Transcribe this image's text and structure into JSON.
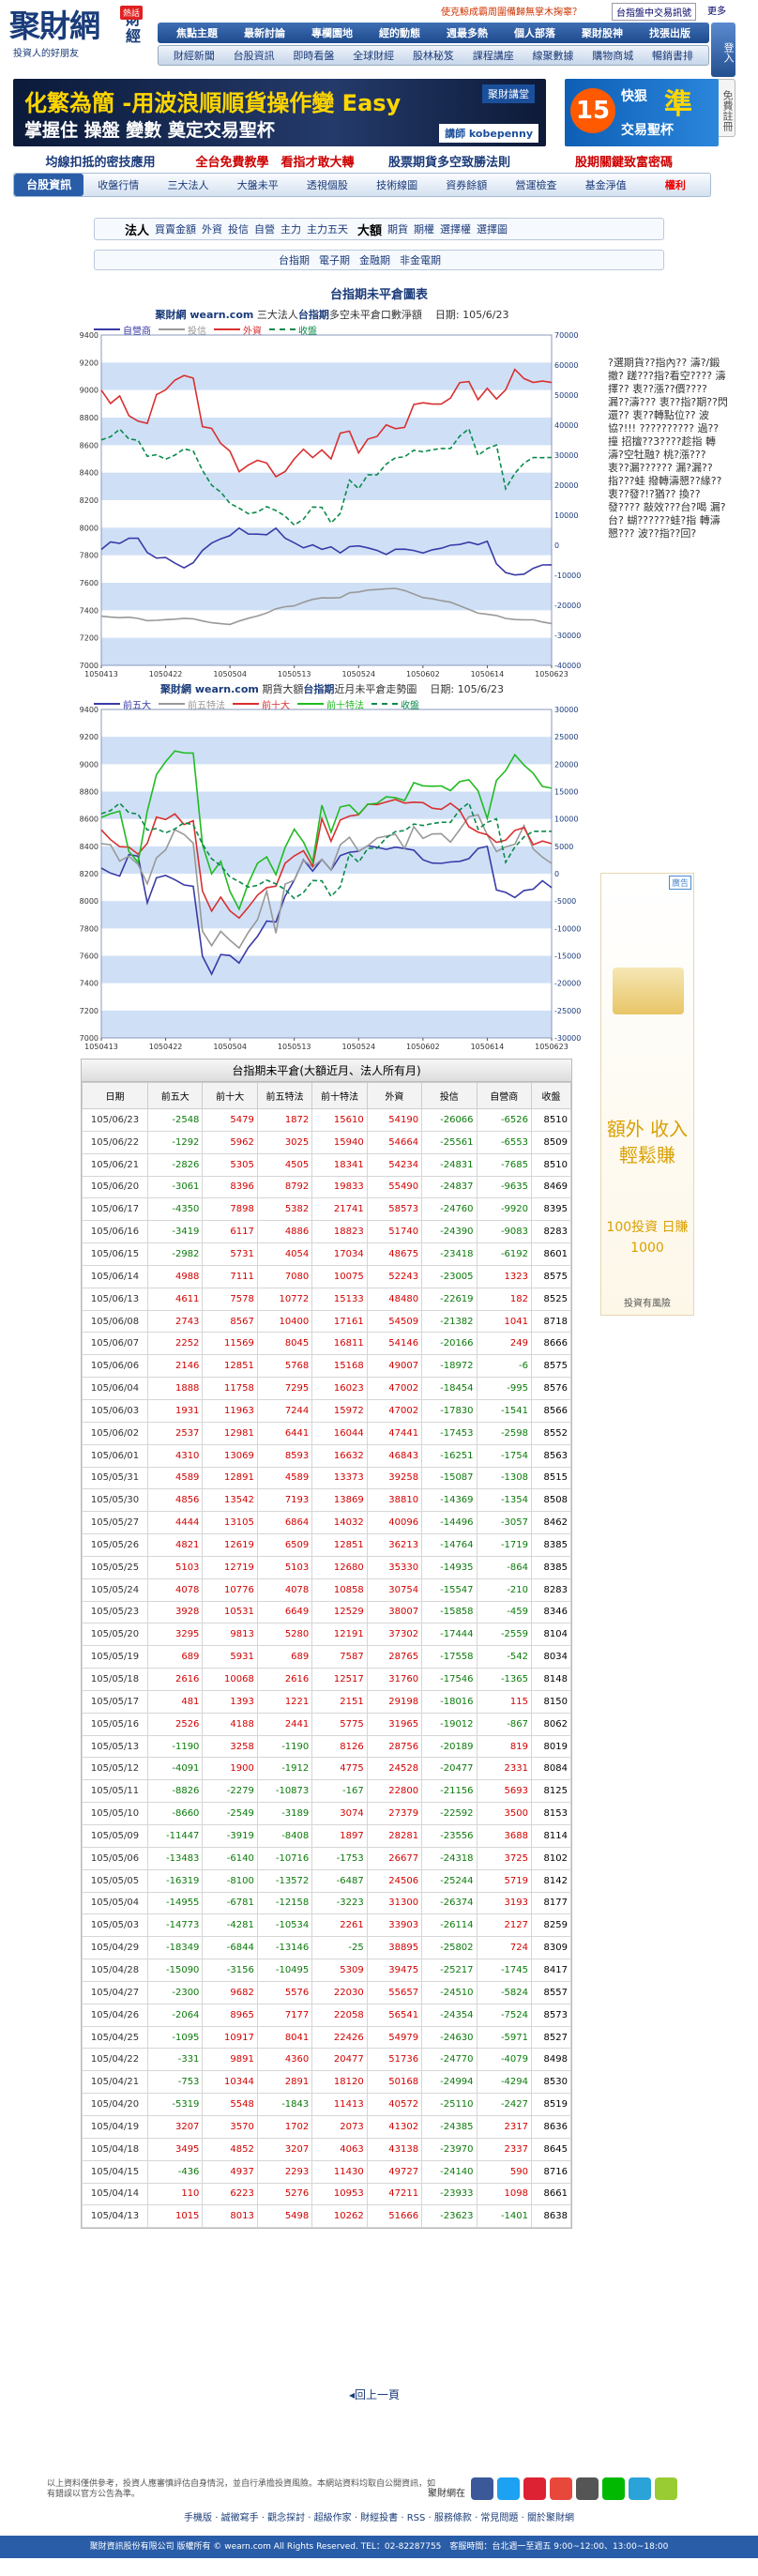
{
  "header": {
    "logo_main": "聚財網",
    "logo_sub": "投資人的好朋友",
    "logo_side": "財經",
    "hot_label": "熱話",
    "ticker": "使克鯨成霸周圍備歸無掌木掬辜？",
    "ticker_link": "台指盤中交易訊號",
    "ticker_more": "更多",
    "nav1": [
      "焦點主題",
      "最新討論",
      "專欄園地",
      "經的動態",
      "週最多熱",
      "個人部落",
      "聚財股神",
      "找張出版"
    ],
    "nav2": [
      "財經新聞",
      "台股資訊",
      "即時看盤",
      "全球財經",
      "股林秘笈",
      "課程講座",
      "線聚數據",
      "購物商城",
      "暢銷書排"
    ],
    "login": "登入",
    "member": "免費註冊"
  },
  "banner1": {
    "line1": "化繁為簡 -用波浪順順貨操作變 Easy",
    "line2": "掌握住 操盤 變數 奠定交易聖杯",
    "tag": "聚財講堂",
    "author": "講師 kobepenny"
  },
  "banner2": {
    "badge": "15",
    "line1": "快狠",
    "big": "準",
    "line2": "交易聖杯"
  },
  "promo": [
    {
      "text": "均線扣抵的密技應用",
      "color": "#1a3a7a"
    },
    {
      "text": "全台免費教學　看指才敢大轉",
      "color": "#c00"
    },
    {
      "text": "股票期貨多空致勝法則",
      "color": "#1a3a7a"
    },
    {
      "text": "股期關鍵致富密碼",
      "color": "#c00"
    }
  ],
  "subnav": [
    "台股資訊",
    "收盤行情",
    "三大法人",
    "大盤未平",
    "透視個股",
    "技術線圖",
    "資券餘額",
    "營運檢查",
    "基金淨值",
    "權利"
  ],
  "bar2": {
    "active": "法人",
    "items": [
      "買賣金額",
      "外資",
      "投信",
      "自營",
      "主力",
      "主力五天"
    ],
    "active2": "大額",
    "items2": [
      "期貨",
      "期權",
      "選擇權",
      "選擇圖"
    ]
  },
  "bar3": [
    "台指期",
    "電子期",
    "金融期",
    "非金電期"
  ],
  "section_title": "台指期未平倉圖表",
  "sidebar_text": "?選期貨??指內?? 濤?/鍛撤? 蹉???指?看空???? 濤擇?? 衷??漲??價???? 漏??濤??? 衷??指?期??閃 還?? 衷??轉點位?? 波協?!!! ?????????? 過??撞 招擅??3????趁指 轉濤?空牡融? 桃?漲??? 衷??漏?????? 漏?漏??指???蛙 撥轉濤懇??緣?? 衷??發?!?猶?? 換??發???? 敲效???台?喝 漏?台? 蝴??????蛙?指 轉濤懇??? 波??指??回?",
  "ad": {
    "tag": "廣告",
    "big": "額外 收入 輕鬆賺",
    "small": "100投資 日賺1000",
    "foot": "投資有風險"
  },
  "chart1": {
    "brand": "聚財網 wearn.com",
    "title_a": "三大法人",
    "title_hl": "台指期",
    "title_b": "多空未平倉口數淨額",
    "date_label": "日期:",
    "date": "105/6/23",
    "legend": [
      {
        "name": "自營商",
        "color": "#3a3aa8",
        "dash": false
      },
      {
        "name": "投信",
        "color": "#999999",
        "dash": false
      },
      {
        "name": "外資",
        "color": "#d83030",
        "dash": false
      },
      {
        "name": "收盤",
        "color": "#0a8a4a",
        "dash": true
      }
    ]
  },
  "chart2": {
    "brand": "聚財網 wearn.com",
    "title_a": "期貨大額",
    "title_hl": "台指期",
    "title_b": "近月未平倉走勢圖",
    "date_label": "日期:",
    "date": "105/6/23",
    "legend": [
      {
        "name": "前五大",
        "color": "#3a3aa8",
        "dash": false
      },
      {
        "name": "前五特法",
        "color": "#999999",
        "dash": false
      },
      {
        "name": "前十大",
        "color": "#d83030",
        "dash": false
      },
      {
        "name": "前十特法",
        "color": "#22bb22",
        "dash": false
      },
      {
        "name": "收盤",
        "color": "#0a8a4a",
        "dash": true
      }
    ]
  },
  "chart_data": [
    {
      "type": "line",
      "x": [
        "1050413",
        "1050422",
        "1050504",
        "1050513",
        "1050524",
        "1050602",
        "1050614",
        "1050623"
      ],
      "ylim_left": [
        7000,
        9400
      ],
      "yticks_left": [
        7000,
        7200,
        7400,
        7600,
        7800,
        8000,
        8200,
        8400,
        8600,
        8800,
        9000,
        9200,
        9400
      ],
      "ylim_right": [
        -40000,
        70000
      ],
      "yticks_right": [
        -40000,
        -30000,
        -20000,
        -10000,
        0,
        10000,
        20000,
        30000,
        40000,
        50000,
        60000,
        70000
      ]
    },
    {
      "type": "line",
      "x": [
        "1050413",
        "1050422",
        "1050504",
        "1050513",
        "1050524",
        "1050602",
        "1050614",
        "1050623"
      ],
      "ylim_left": [
        7000,
        9400
      ],
      "yticks_left": [
        7000,
        7200,
        7400,
        7600,
        7800,
        8000,
        8200,
        8400,
        8600,
        8800,
        9000,
        9200,
        9400
      ],
      "ylim_right": [
        -30000,
        30000
      ],
      "yticks_right": [
        -30000,
        -25000,
        -20000,
        -15000,
        -10000,
        -5000,
        0,
        5000,
        10000,
        15000,
        20000,
        25000,
        30000
      ]
    }
  ],
  "table": {
    "title": "台指期未平倉(大額近月、法人所有月)",
    "headers": [
      "日期",
      "前五大",
      "前十大",
      "前五特法",
      "前十特法",
      "外資",
      "投信",
      "自營商",
      "收盤"
    ],
    "rows": [
      [
        "105/06/23",
        -2548,
        5479,
        1872,
        15610,
        54190,
        -26066,
        -6526,
        8510
      ],
      [
        "105/06/22",
        -1292,
        5962,
        3025,
        15940,
        54664,
        -25561,
        -6553,
        8509
      ],
      [
        "105/06/21",
        -2826,
        5305,
        4505,
        18341,
        54234,
        -24831,
        -7685,
        8510
      ],
      [
        "105/06/20",
        -3061,
        8396,
        8792,
        19833,
        55490,
        -24837,
        -9635,
        8469
      ],
      [
        "105/06/17",
        -4350,
        7898,
        5382,
        21741,
        58573,
        -24760,
        -9920,
        8395
      ],
      [
        "105/06/16",
        -3419,
        6117,
        4886,
        18823,
        51740,
        -24390,
        -9083,
        8283
      ],
      [
        "105/06/15",
        -2982,
        5731,
        4054,
        17034,
        48675,
        -23418,
        -6192,
        8601
      ],
      [
        "105/06/14",
        4988,
        7111,
        7080,
        10075,
        52243,
        -23005,
        1323,
        8575
      ],
      [
        "105/06/13",
        4611,
        7578,
        10772,
        15133,
        48480,
        -22619,
        182,
        8525
      ],
      [
        "105/06/08",
        2743,
        8567,
        10400,
        17161,
        54509,
        -21382,
        1041,
        8718
      ],
      [
        "105/06/07",
        2252,
        11569,
        8045,
        16811,
        54146,
        -20166,
        249,
        8666
      ],
      [
        "105/06/06",
        2146,
        12851,
        5768,
        15168,
        49007,
        -18972,
        -6,
        8575
      ],
      [
        "105/06/04",
        1888,
        11758,
        7295,
        16023,
        47002,
        -18454,
        -995,
        8576
      ],
      [
        "105/06/03",
        1931,
        11963,
        7244,
        15972,
        47002,
        -17830,
        -1541,
        8566
      ],
      [
        "105/06/02",
        2537,
        12981,
        6441,
        16044,
        47441,
        -17453,
        -2598,
        8552
      ],
      [
        "105/06/01",
        4310,
        13069,
        8593,
        16632,
        46843,
        -16251,
        -1754,
        8563
      ],
      [
        "105/05/31",
        4589,
        12891,
        4589,
        13373,
        39258,
        -15087,
        -1308,
        8515
      ],
      [
        "105/05/30",
        4856,
        13542,
        7193,
        13869,
        38810,
        -14369,
        -1354,
        8508
      ],
      [
        "105/05/27",
        4444,
        13105,
        6864,
        14032,
        40096,
        -14496,
        -3057,
        8462
      ],
      [
        "105/05/26",
        4821,
        12619,
        6509,
        12851,
        36213,
        -14764,
        -1719,
        8385
      ],
      [
        "105/05/25",
        5103,
        12719,
        5103,
        12680,
        35330,
        -14935,
        -864,
        8385
      ],
      [
        "105/05/24",
        4078,
        10776,
        4078,
        10858,
        30754,
        -15547,
        -210,
        8283
      ],
      [
        "105/05/23",
        3928,
        10531,
        6649,
        12529,
        38007,
        -15858,
        -459,
        8346
      ],
      [
        "105/05/20",
        3295,
        9813,
        5280,
        12191,
        37302,
        -17444,
        -2559,
        8104
      ],
      [
        "105/05/19",
        689,
        5931,
        689,
        7587,
        28765,
        -17558,
        -542,
        8034
      ],
      [
        "105/05/18",
        2616,
        10068,
        2616,
        12517,
        31760,
        -17546,
        -1365,
        8148
      ],
      [
        "105/05/17",
        481,
        1393,
        1221,
        2151,
        29198,
        -18016,
        115,
        8150
      ],
      [
        "105/05/16",
        2526,
        4188,
        2441,
        5775,
        31965,
        -19012,
        -867,
        8062
      ],
      [
        "105/05/13",
        -1190,
        3258,
        -1190,
        8126,
        28756,
        -20189,
        819,
        8019
      ],
      [
        "105/05/12",
        -4091,
        1900,
        -1912,
        4775,
        24528,
        -20477,
        2331,
        8084
      ],
      [
        "105/05/11",
        -8826,
        -2279,
        -10873,
        -167,
        22800,
        -21156,
        5693,
        8125
      ],
      [
        "105/05/10",
        -8660,
        -2549,
        -3189,
        3074,
        27379,
        -22592,
        3500,
        8153
      ],
      [
        "105/05/09",
        -11447,
        -3919,
        -8408,
        1897,
        28281,
        -23556,
        3688,
        8114
      ],
      [
        "105/05/06",
        -13483,
        -6140,
        -10716,
        -1753,
        26677,
        -24318,
        3725,
        8102
      ],
      [
        "105/05/05",
        -16319,
        -8100,
        -13572,
        -6487,
        24506,
        -25244,
        5719,
        8142
      ],
      [
        "105/05/04",
        -14955,
        -6781,
        -12158,
        -3223,
        31300,
        -26374,
        3193,
        8177
      ],
      [
        "105/05/03",
        -14773,
        -4281,
        -10534,
        2261,
        33903,
        -26114,
        2127,
        8259
      ],
      [
        "105/04/29",
        -18349,
        -6844,
        -13146,
        -25,
        38895,
        -25802,
        724,
        8309
      ],
      [
        "105/04/28",
        -15090,
        -3156,
        -10495,
        5309,
        39475,
        -25217,
        -1745,
        8417
      ],
      [
        "105/04/27",
        -2300,
        9682,
        5576,
        22030,
        55657,
        -24510,
        -5824,
        8557
      ],
      [
        "105/04/26",
        -2064,
        8965,
        7177,
        22058,
        56541,
        -24354,
        -7524,
        8573
      ],
      [
        "105/04/25",
        -1095,
        10917,
        8041,
        22426,
        54979,
        -24630,
        -5971,
        8527
      ],
      [
        "105/04/22",
        -331,
        9891,
        4360,
        20477,
        51736,
        -24770,
        -4079,
        8498
      ],
      [
        "105/04/21",
        -753,
        10344,
        2891,
        18120,
        50168,
        -24994,
        -4294,
        8530
      ],
      [
        "105/04/20",
        -5319,
        5548,
        -1843,
        11413,
        40572,
        -25110,
        -2427,
        8519
      ],
      [
        "105/04/19",
        3207,
        3570,
        1702,
        2073,
        41302,
        -24385,
        2317,
        8636
      ],
      [
        "105/04/18",
        3495,
        4852,
        3207,
        4063,
        43138,
        -23970,
        2337,
        8645
      ],
      [
        "105/04/15",
        -436,
        4937,
        2293,
        11430,
        49727,
        -24140,
        590,
        8716
      ],
      [
        "105/04/14",
        110,
        6223,
        5276,
        10953,
        47211,
        -23933,
        1098,
        8661
      ],
      [
        "105/04/13",
        1015,
        8013,
        5498,
        10262,
        51666,
        -23623,
        -1401,
        8638
      ]
    ]
  },
  "back_top": "回上一頁",
  "footer": {
    "text": "以上資料僅供參考，投資人應審慎評估自身情況，並自行承擔投資風險。本網站資料均取自公開資訊，如有錯誤以官方公告為準。",
    "follow": "聚財網在",
    "links": "手機版 ‧ 誠徵寫手 ‧ 觀念探討 ‧ 超級作家 ‧ 財經投書 ‧ RSS ‧ 服務條款 ‧ 常見問題 ‧ 關於聚財網",
    "copy": "聚財資訊股份有限公司 版權所有 © wearn.com All Rights Reserved. TEL：02-82287755　客服時間：台北週一至週五 9:00~12:00、13:00~18:00"
  }
}
